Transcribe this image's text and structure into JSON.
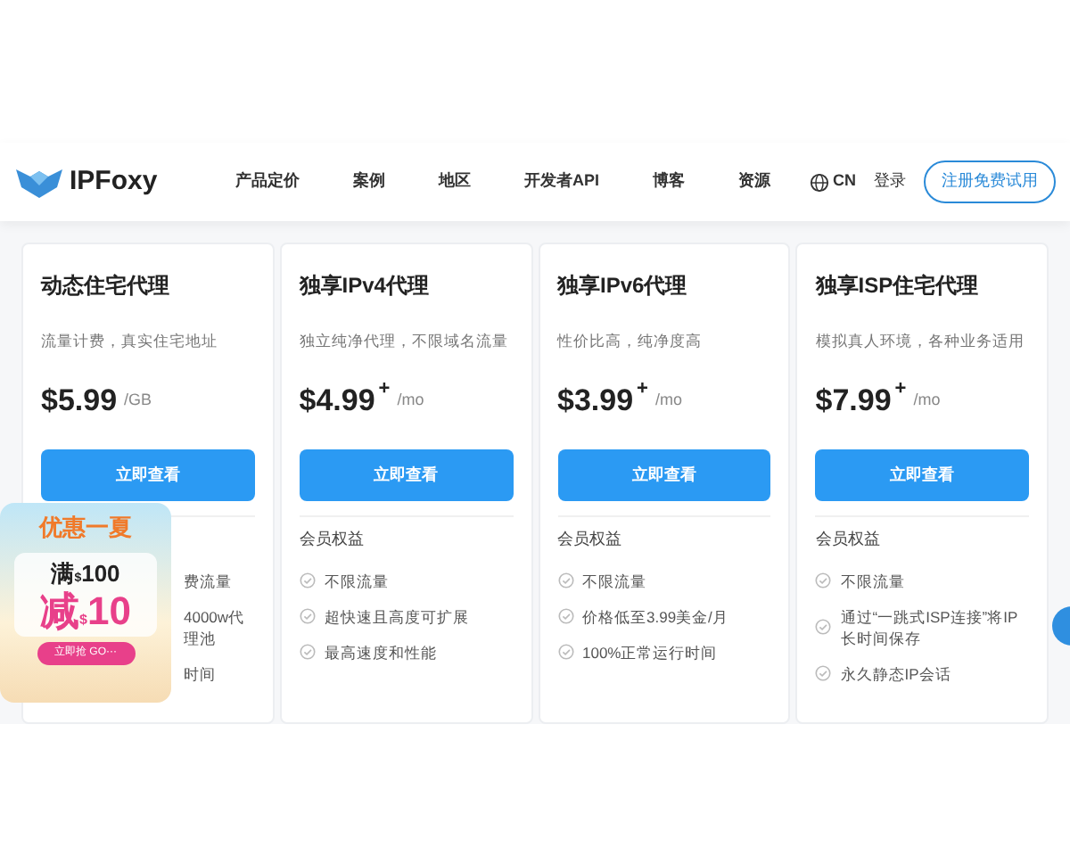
{
  "nav": {
    "logo": "IPFoxy",
    "links": [
      "产品定价",
      "案例",
      "地区",
      "开发者API",
      "博客",
      "资源"
    ],
    "language": "CN",
    "login": "登录",
    "signup": "注册免费试用"
  },
  "cards": [
    {
      "title": "动态住宅代理",
      "subtitle": "流量计费，真实住宅地址",
      "price": "$5.99",
      "unit": "/GB",
      "button": "立即查看",
      "features": [
        "费流量",
        "4000w代理池",
        "时间"
      ],
      "kind": "covered"
    },
    {
      "title": "独享IPv4代理",
      "subtitle": "独立纯净代理，不限域名流量",
      "price": "$4.99",
      "plus": "+",
      "unit": "/mo",
      "button": "立即查看",
      "benefits_title": "会员权益",
      "features": [
        "不限流量",
        "超快速且高度可扩展",
        "最高速度和性能"
      ],
      "kind": "plan"
    },
    {
      "title": "独享IPv6代理",
      "subtitle": "性价比高，纯净度高",
      "price": "$3.99",
      "plus": "+",
      "unit": "/mo",
      "button": "立即查看",
      "benefits_title": "会员权益",
      "features": [
        "不限流量",
        "价格低至3.99美金/月",
        "100%正常运行时间"
      ],
      "kind": "plan"
    },
    {
      "title": "独享ISP住宅代理",
      "subtitle": "模拟真人环境，各种业务适用",
      "price": "$7.99",
      "plus": "+",
      "unit": "/mo",
      "button": "立即查看",
      "benefits_title": "会员权益",
      "features": [
        "不限流量",
        "通过“一跳式ISP连接”将IP长时间保存",
        "永久静态IP会话"
      ],
      "kind": "plan"
    }
  ],
  "promo": {
    "title": "优惠一夏",
    "line1_a": "满",
    "line1_b": "$",
    "line1_c": "100",
    "line2_a": "减",
    "line2_b": "$",
    "line2_c": "10",
    "button": "立即抢 GO···"
  }
}
